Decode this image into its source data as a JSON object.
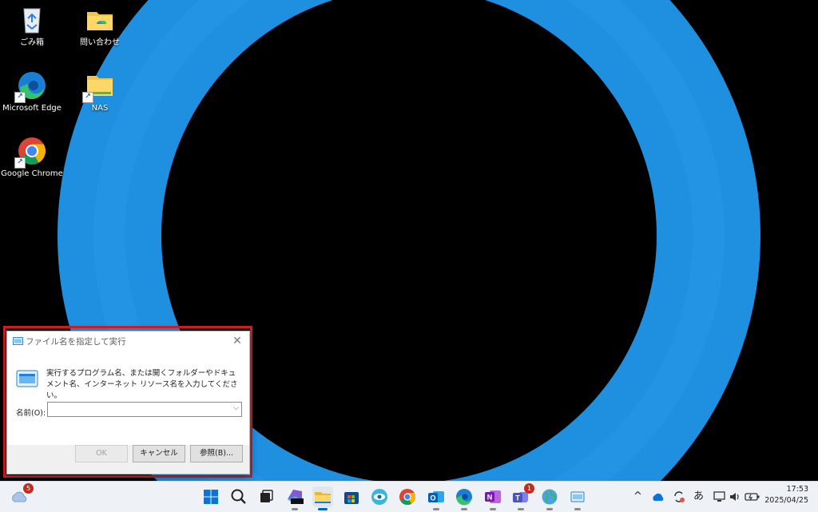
{
  "desktop": {
    "icons": [
      {
        "label": "ごみ箱",
        "icon": "recycle-bin-icon"
      },
      {
        "label": "問い合わせ",
        "icon": "folder-icon"
      },
      {
        "label": "Microsoft Edge",
        "icon": "edge-icon"
      },
      {
        "label": "NAS",
        "icon": "folder-shortcut-icon"
      },
      {
        "label": "Google Chrome",
        "icon": "chrome-icon"
      }
    ],
    "wallpaper_colors": {
      "ring": "#1f8fe0",
      "background": "#000000"
    }
  },
  "run_dialog": {
    "title": "ファイル名を指定して実行",
    "close_glyph": "✕",
    "description": "実行するプログラム名、または開くフォルダーやドキュメント名、インターネット リソース名を入力してください。",
    "name_label": "名前(O):",
    "name_value": "",
    "ok_label": "OK",
    "cancel_label": "キャンセル",
    "browse_label": "参照(B)...",
    "highlight_color": "#d11f26"
  },
  "taskbar": {
    "weather_badge": "5",
    "apps": [
      {
        "name": "start-button",
        "icon": "windows-logo-icon"
      },
      {
        "name": "search",
        "icon": "search-icon"
      },
      {
        "name": "task-view",
        "icon": "task-view-icon"
      },
      {
        "name": "copilot",
        "icon": "m365-icon"
      },
      {
        "name": "file-explorer",
        "icon": "folder-icon",
        "active": true
      },
      {
        "name": "store",
        "icon": "store-icon"
      },
      {
        "name": "app-eye",
        "icon": "eye-icon"
      },
      {
        "name": "chrome",
        "icon": "chrome-icon"
      },
      {
        "name": "outlook",
        "icon": "outlook-icon"
      },
      {
        "name": "edge",
        "icon": "edge-icon"
      },
      {
        "name": "onenote",
        "icon": "onenote-icon"
      },
      {
        "name": "teams",
        "icon": "teams-icon",
        "badge": "1"
      },
      {
        "name": "globe-app",
        "icon": "globe-icon"
      },
      {
        "name": "run",
        "icon": "run-icon"
      }
    ],
    "tray": {
      "chevron": "^",
      "ime": "あ",
      "time": "17:53",
      "date": "2025/04/25"
    }
  }
}
